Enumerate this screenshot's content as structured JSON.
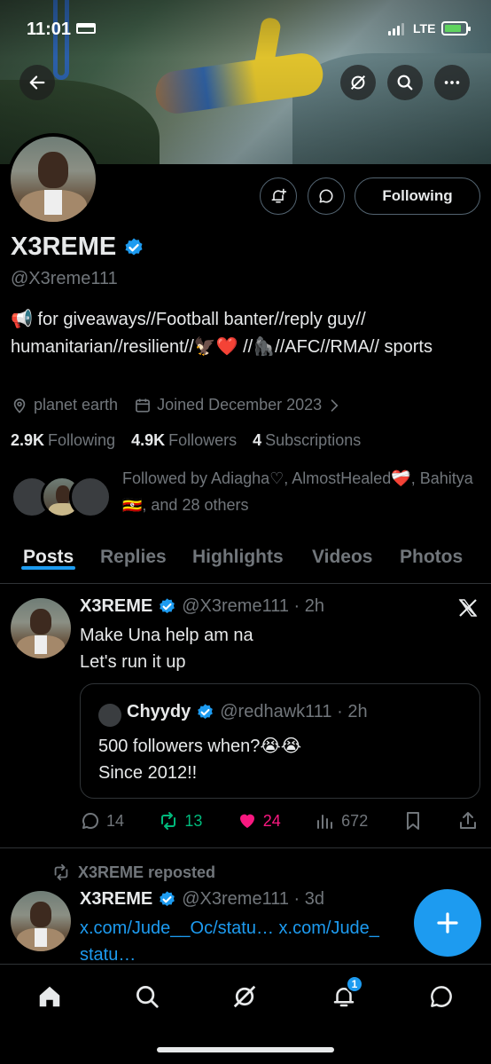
{
  "status_bar": {
    "time": "11:01",
    "network": "LTE"
  },
  "banner": {
    "description_icon": "bungee-jump-photo"
  },
  "header_icons": {
    "back": "back-arrow-icon",
    "grok": "grok-icon",
    "search": "search-icon",
    "more": "more-icon"
  },
  "profile": {
    "name": "X3REME",
    "handle": "@X3reme111",
    "bio": "📢 for giveaways//Football banter//reply guy// humanitarian//resilient//🦅❤️ //🦍//AFC//RMA// sports",
    "location": "planet earth",
    "joined": "Joined December 2023",
    "following_count": "2.9K",
    "following_label": "Following",
    "followers_count": "4.9K",
    "followers_label": "Followers",
    "subscriptions_count": "4",
    "subscriptions_label": "Subscriptions",
    "followed_by": "Followed by Adiagha♡, AlmostHealed❤️‍🩹, Bahitya 🇺🇬, and 28 others",
    "following_button": "Following"
  },
  "tabs": [
    "Posts",
    "Replies",
    "Highlights",
    "Videos",
    "Photos"
  ],
  "post1": {
    "name": "X3REME",
    "meta": "@X3reme111 · 2h",
    "text_line1": "Make Una help am na",
    "text_line2": "Let's run it up",
    "quote": {
      "name": "Chyydy",
      "meta": "@redhawk111 · 2h",
      "text_line1": "500 followers when?😭😭",
      "text_line2": "Since 2012!!"
    },
    "replies": "14",
    "reposts": "13",
    "likes": "24",
    "views": "672"
  },
  "post2": {
    "repost_label": "X3REME reposted",
    "name": "X3REME",
    "meta": "@X3reme111 · 3d",
    "text_line1": "x.com/Jude__Oc/statu… x.com/Jude_",
    "text_line2": "statu…"
  },
  "nav": {
    "notifications_badge": "1"
  },
  "colors": {
    "accent": "#1d9bf0",
    "like": "#f91880",
    "repost": "#00ba7c",
    "background": "#000000"
  }
}
